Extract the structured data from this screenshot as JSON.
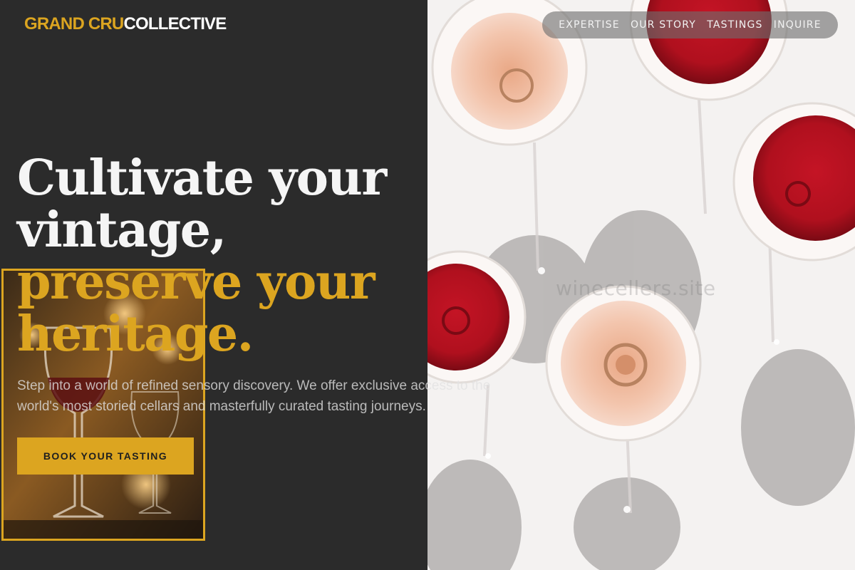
{
  "brand": {
    "part1": "GRAND CRU",
    "part2": "COLLECTIVE"
  },
  "nav": {
    "items": [
      {
        "label": "EXPERTISE"
      },
      {
        "label": "OUR STORY"
      },
      {
        "label": "TASTINGS"
      },
      {
        "label": "INQUIRE"
      }
    ]
  },
  "hero": {
    "line1": "Cultivate your",
    "line2": "vintage,",
    "line3": "preserve your",
    "line4": "heritage."
  },
  "description": "Step into a world of refined sensory discovery. We offer exclusive access to the world's most storied cellars and masterfully curated tasting journeys.",
  "cta": {
    "label": "BOOK YOUR TASTING"
  },
  "watermark": "winecellers.site",
  "colors": {
    "accent": "#dca520",
    "background": "#2b2b2b",
    "text": "#f5f5f5"
  }
}
